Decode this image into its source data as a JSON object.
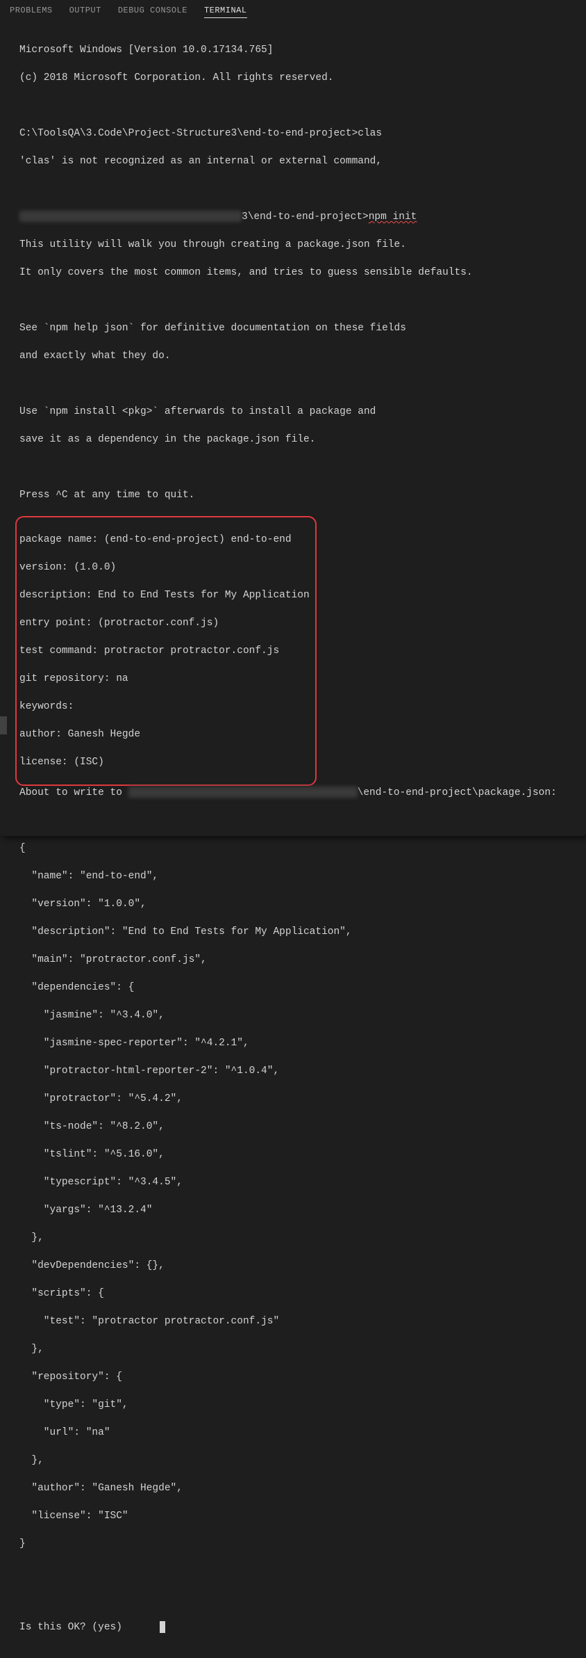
{
  "tabs": {
    "problems": "PROBLEMS",
    "output": "OUTPUT",
    "debug_console": "DEBUG CONSOLE",
    "terminal": "TERMINAL"
  },
  "terminal": {
    "win_version": "Microsoft Windows [Version 10.0.17134.765]",
    "copyright": "(c) 2018 Microsoft Corporation. All rights reserved.",
    "prompt1_path": "C:\\ToolsQA\\3.Code\\Project-Structure3\\end-to-end-project>",
    "prompt1_cmd": "clas",
    "error_line": "'clas' is not recognized as an internal or external command,",
    "prompt2_path_suffix": "3\\end-to-end-project>",
    "prompt2_cmd": "npm init",
    "intro1": "This utility will walk you through creating a package.json file.",
    "intro2": "It only covers the most common items, and tries to guess sensible defaults.",
    "intro3": "See `npm help json` for definitive documentation on these fields",
    "intro4": "and exactly what they do.",
    "intro5": "Use `npm install <pkg>` afterwards to install a package and",
    "intro6": "save it as a dependency in the package.json file.",
    "intro7": "Press ^C at any time to quit.",
    "box": {
      "l1": "package name: (end-to-end-project) end-to-end",
      "l2": "version: (1.0.0) ",
      "l3": "description: End to End Tests for My Application",
      "l4": "entry point: (protractor.conf.js) ",
      "l5": "test command: protractor protractor.conf.js",
      "l6": "git repository: na",
      "l7": "keywords: ",
      "l8": "author: Ganesh Hegde",
      "l9": "license: (ISC) "
    },
    "about_prefix": "About to write to ",
    "about_suffix": "\\end-to-end-project\\package.json:",
    "json_l1": "{",
    "json_l2": "  \"name\": \"end-to-end\",",
    "json_l3": "  \"version\": \"1.0.0\",",
    "json_l4": "  \"description\": \"End to End Tests for My Application\",",
    "json_l5": "  \"main\": \"protractor.conf.js\",",
    "json_l6": "  \"dependencies\": {",
    "json_l7": "    \"jasmine\": \"^3.4.0\",",
    "json_l8": "    \"jasmine-spec-reporter\": \"^4.2.1\",",
    "json_l9": "    \"protractor-html-reporter-2\": \"^1.0.4\",",
    "json_l10": "    \"protractor\": \"^5.4.2\",",
    "json_l11": "    \"ts-node\": \"^8.2.0\",",
    "json_l12": "    \"tslint\": \"^5.16.0\",",
    "json_l13": "    \"typescript\": \"^3.4.5\",",
    "json_l14": "    \"yargs\": \"^13.2.4\"",
    "json_l15": "  },",
    "json_l16": "  \"devDependencies\": {},",
    "json_l17": "  \"scripts\": {",
    "json_l18": "    \"test\": \"protractor protractor.conf.js\"",
    "json_l19": "  },",
    "json_l20": "  \"repository\": {",
    "json_l21": "    \"type\": \"git\",",
    "json_l22": "    \"url\": \"na\"",
    "json_l23": "  },",
    "json_l24": "  \"author\": \"Ganesh Hegde\",",
    "json_l25": "  \"license\": \"ISC\"",
    "json_l26": "}",
    "confirm": "Is this OK? (yes) "
  }
}
